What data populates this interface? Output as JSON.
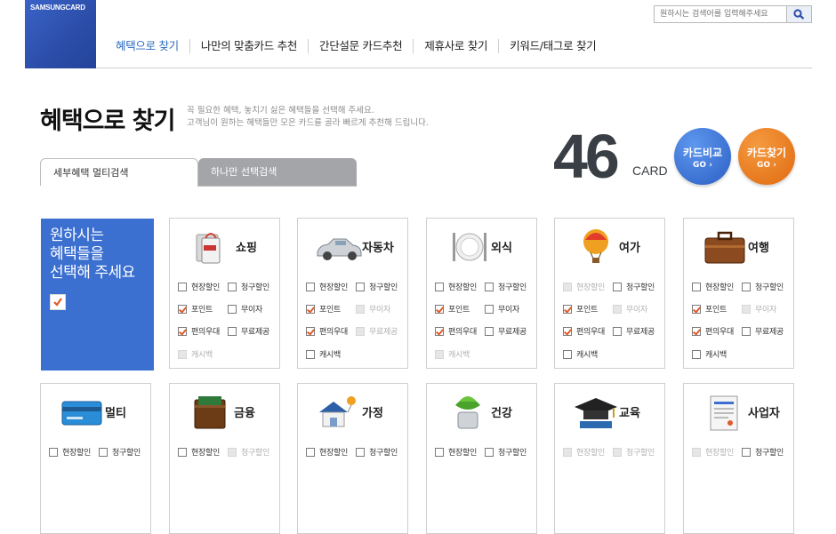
{
  "brand": {
    "logo_text": "SAMSUNGCARD"
  },
  "search": {
    "placeholder": "원하시는 검색어를 입력해주세요"
  },
  "nav": [
    "혜택으로 찾기",
    "나만의 맞춤카드 추천",
    "간단설문 카드추천",
    "제휴사로 찾기",
    "키워드/태그로 찾기"
  ],
  "page": {
    "title": "혜택으로 찾기",
    "desc1": "꼭 필요한 혜택, 놓치기 싫은 혜택들을 선택해 주세요.",
    "desc2": "고객님이 원하는 혜택들만 모은 카드를 골라 빠르게 추천해 드립니다."
  },
  "result": {
    "count": "46",
    "unit": "CARD"
  },
  "buttons": {
    "compare": "카드비교",
    "find": "카드찾기",
    "go": "GO ›"
  },
  "tabs": [
    "세부혜택 멀티검색",
    "하나만 선택검색"
  ],
  "intro": {
    "line1": "원하시는",
    "line2": "혜택들을",
    "line3": "선택해 주세요"
  },
  "categories": [
    {
      "name": "쇼핑",
      "icon": "shopping-bag-icon",
      "options": [
        {
          "label": "현장할인",
          "checked": false,
          "disabled": false
        },
        {
          "label": "청구할인",
          "checked": false,
          "disabled": false
        },
        {
          "label": "포인트",
          "checked": true,
          "disabled": false
        },
        {
          "label": "무이자",
          "checked": false,
          "disabled": false
        },
        {
          "label": "편의우대",
          "checked": true,
          "disabled": false
        },
        {
          "label": "무료제공",
          "checked": false,
          "disabled": false
        },
        {
          "label": "캐시백",
          "checked": false,
          "disabled": true
        }
      ]
    },
    {
      "name": "자동차",
      "icon": "car-icon",
      "options": [
        {
          "label": "현장할인",
          "checked": false,
          "disabled": false
        },
        {
          "label": "청구할인",
          "checked": false,
          "disabled": false
        },
        {
          "label": "포인트",
          "checked": true,
          "disabled": false
        },
        {
          "label": "무이자",
          "checked": false,
          "disabled": true
        },
        {
          "label": "편의우대",
          "checked": true,
          "disabled": false
        },
        {
          "label": "무료제공",
          "checked": false,
          "disabled": true
        },
        {
          "label": "캐시백",
          "checked": false,
          "disabled": false
        }
      ]
    },
    {
      "name": "외식",
      "icon": "dining-icon",
      "options": [
        {
          "label": "현장할인",
          "checked": false,
          "disabled": false
        },
        {
          "label": "청구할인",
          "checked": false,
          "disabled": false
        },
        {
          "label": "포인트",
          "checked": true,
          "disabled": false
        },
        {
          "label": "무이자",
          "checked": false,
          "disabled": false
        },
        {
          "label": "편의우대",
          "checked": true,
          "disabled": false
        },
        {
          "label": "무료제공",
          "checked": false,
          "disabled": false
        },
        {
          "label": "캐시백",
          "checked": false,
          "disabled": true
        }
      ]
    },
    {
      "name": "여가",
      "icon": "balloon-icon",
      "options": [
        {
          "label": "현장할인",
          "checked": false,
          "disabled": true
        },
        {
          "label": "청구할인",
          "checked": false,
          "disabled": false
        },
        {
          "label": "포인트",
          "checked": true,
          "disabled": false
        },
        {
          "label": "무이자",
          "checked": false,
          "disabled": true
        },
        {
          "label": "편의우대",
          "checked": true,
          "disabled": false
        },
        {
          "label": "무료제공",
          "checked": false,
          "disabled": false
        },
        {
          "label": "캐시백",
          "checked": false,
          "disabled": false
        }
      ]
    },
    {
      "name": "여행",
      "icon": "suitcase-icon",
      "options": [
        {
          "label": "현장할인",
          "checked": false,
          "disabled": false
        },
        {
          "label": "청구할인",
          "checked": false,
          "disabled": false
        },
        {
          "label": "포인트",
          "checked": true,
          "disabled": false
        },
        {
          "label": "무이자",
          "checked": false,
          "disabled": true
        },
        {
          "label": "편의우대",
          "checked": true,
          "disabled": false
        },
        {
          "label": "무료제공",
          "checked": false,
          "disabled": false
        },
        {
          "label": "캐시백",
          "checked": false,
          "disabled": false
        }
      ]
    },
    {
      "name": "멀티",
      "icon": "credit-card-icon",
      "options": [
        {
          "label": "현장할인",
          "checked": false,
          "disabled": false
        },
        {
          "label": "청구할인",
          "checked": false,
          "disabled": false
        }
      ]
    },
    {
      "name": "금융",
      "icon": "wallet-icon",
      "options": [
        {
          "label": "현장할인",
          "checked": false,
          "disabled": false
        },
        {
          "label": "청구할인",
          "checked": false,
          "disabled": true
        }
      ]
    },
    {
      "name": "가정",
      "icon": "house-icon",
      "options": [
        {
          "label": "현장할인",
          "checked": false,
          "disabled": false
        },
        {
          "label": "청구할인",
          "checked": false,
          "disabled": false
        }
      ]
    },
    {
      "name": "건강",
      "icon": "plant-icon",
      "options": [
        {
          "label": "현장할인",
          "checked": false,
          "disabled": false
        },
        {
          "label": "청구할인",
          "checked": false,
          "disabled": false
        }
      ]
    },
    {
      "name": "교육",
      "icon": "graduation-cap-icon",
      "options": [
        {
          "label": "현장할인",
          "checked": false,
          "disabled": true
        },
        {
          "label": "청구할인",
          "checked": false,
          "disabled": true
        }
      ]
    },
    {
      "name": "사업자",
      "icon": "document-icon",
      "options": [
        {
          "label": "현장할인",
          "checked": false,
          "disabled": true
        },
        {
          "label": "청구할인",
          "checked": false,
          "disabled": false
        }
      ]
    }
  ],
  "colors": {
    "accent": "#3b6fd0",
    "compare_button": "#2c5fc4",
    "find_button": "#e06a10",
    "check": "#e05a2b"
  }
}
